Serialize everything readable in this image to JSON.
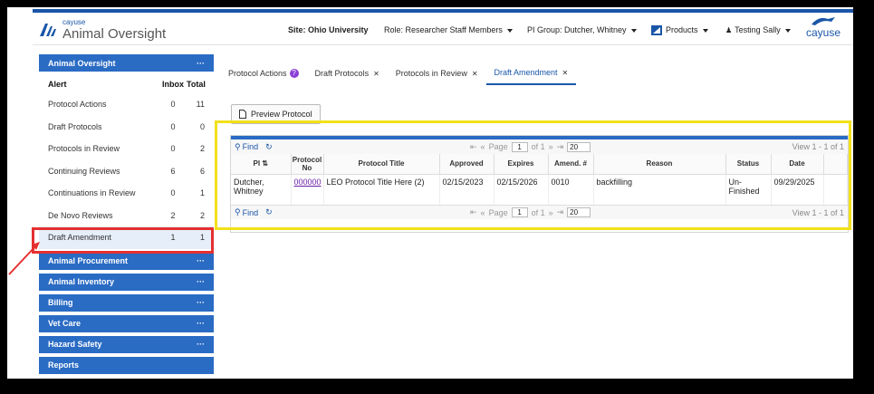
{
  "header": {
    "brand_small": "cayuse",
    "brand_big": "Animal Oversight",
    "site": "Site: Ohio University",
    "role": "Role: Researcher Staff Members",
    "pi_group": "PI Group: Dutcher, Whitney",
    "products": "Products",
    "user": "Testing Sally",
    "logo_text": "cayuse"
  },
  "sidebar": {
    "section_title": "Animal Oversight",
    "col_alert": "Alert",
    "col_inbox": "Inbox",
    "col_total": "Total",
    "rows": [
      {
        "label": "Protocol Actions",
        "inbox": "0",
        "total": "11"
      },
      {
        "label": "Draft Protocols",
        "inbox": "0",
        "total": "0"
      },
      {
        "label": "Protocols in Review",
        "inbox": "0",
        "total": "2"
      },
      {
        "label": "Continuing Reviews",
        "inbox": "6",
        "total": "6"
      },
      {
        "label": "Continuations in Review",
        "inbox": "0",
        "total": "1"
      },
      {
        "label": "De Novo Reviews",
        "inbox": "2",
        "total": "2"
      },
      {
        "label": "Draft Amendment",
        "inbox": "1",
        "total": "1"
      }
    ],
    "sections": [
      "Animal Procurement",
      "Animal Inventory",
      "Billing",
      "Vet Care",
      "Hazard Safety",
      "Reports"
    ],
    "more": "···"
  },
  "tabs": [
    {
      "label": "Protocol Actions"
    },
    {
      "label": "Draft Protocols"
    },
    {
      "label": "Protocols in Review"
    },
    {
      "label": "Draft Amendment"
    }
  ],
  "preview_button": "Preview Protocol",
  "grid": {
    "find": "Find",
    "page_label": "Page",
    "page": "1",
    "of": "of 1",
    "per_page": "20",
    "view": "View 1 - 1 of 1",
    "columns": [
      "PI",
      "Protocol No",
      "Protocol Title",
      "Approved",
      "Expires",
      "Amend. #",
      "Reason",
      "Status",
      "Date"
    ],
    "rows": [
      {
        "pi": "Dutcher, Whitney",
        "protocol_no": "000000",
        "title": "LEO Protocol Title Here (2)",
        "approved": "02/15/2023",
        "expires": "02/15/2026",
        "amend": "0010",
        "reason": "backfilling",
        "status": "Un-Finished",
        "date": "09/29/2025"
      }
    ]
  },
  "colors": {
    "accent": "#2a6bc4",
    "highlight_yellow": "#f2e01a",
    "highlight_red": "#e53030"
  }
}
